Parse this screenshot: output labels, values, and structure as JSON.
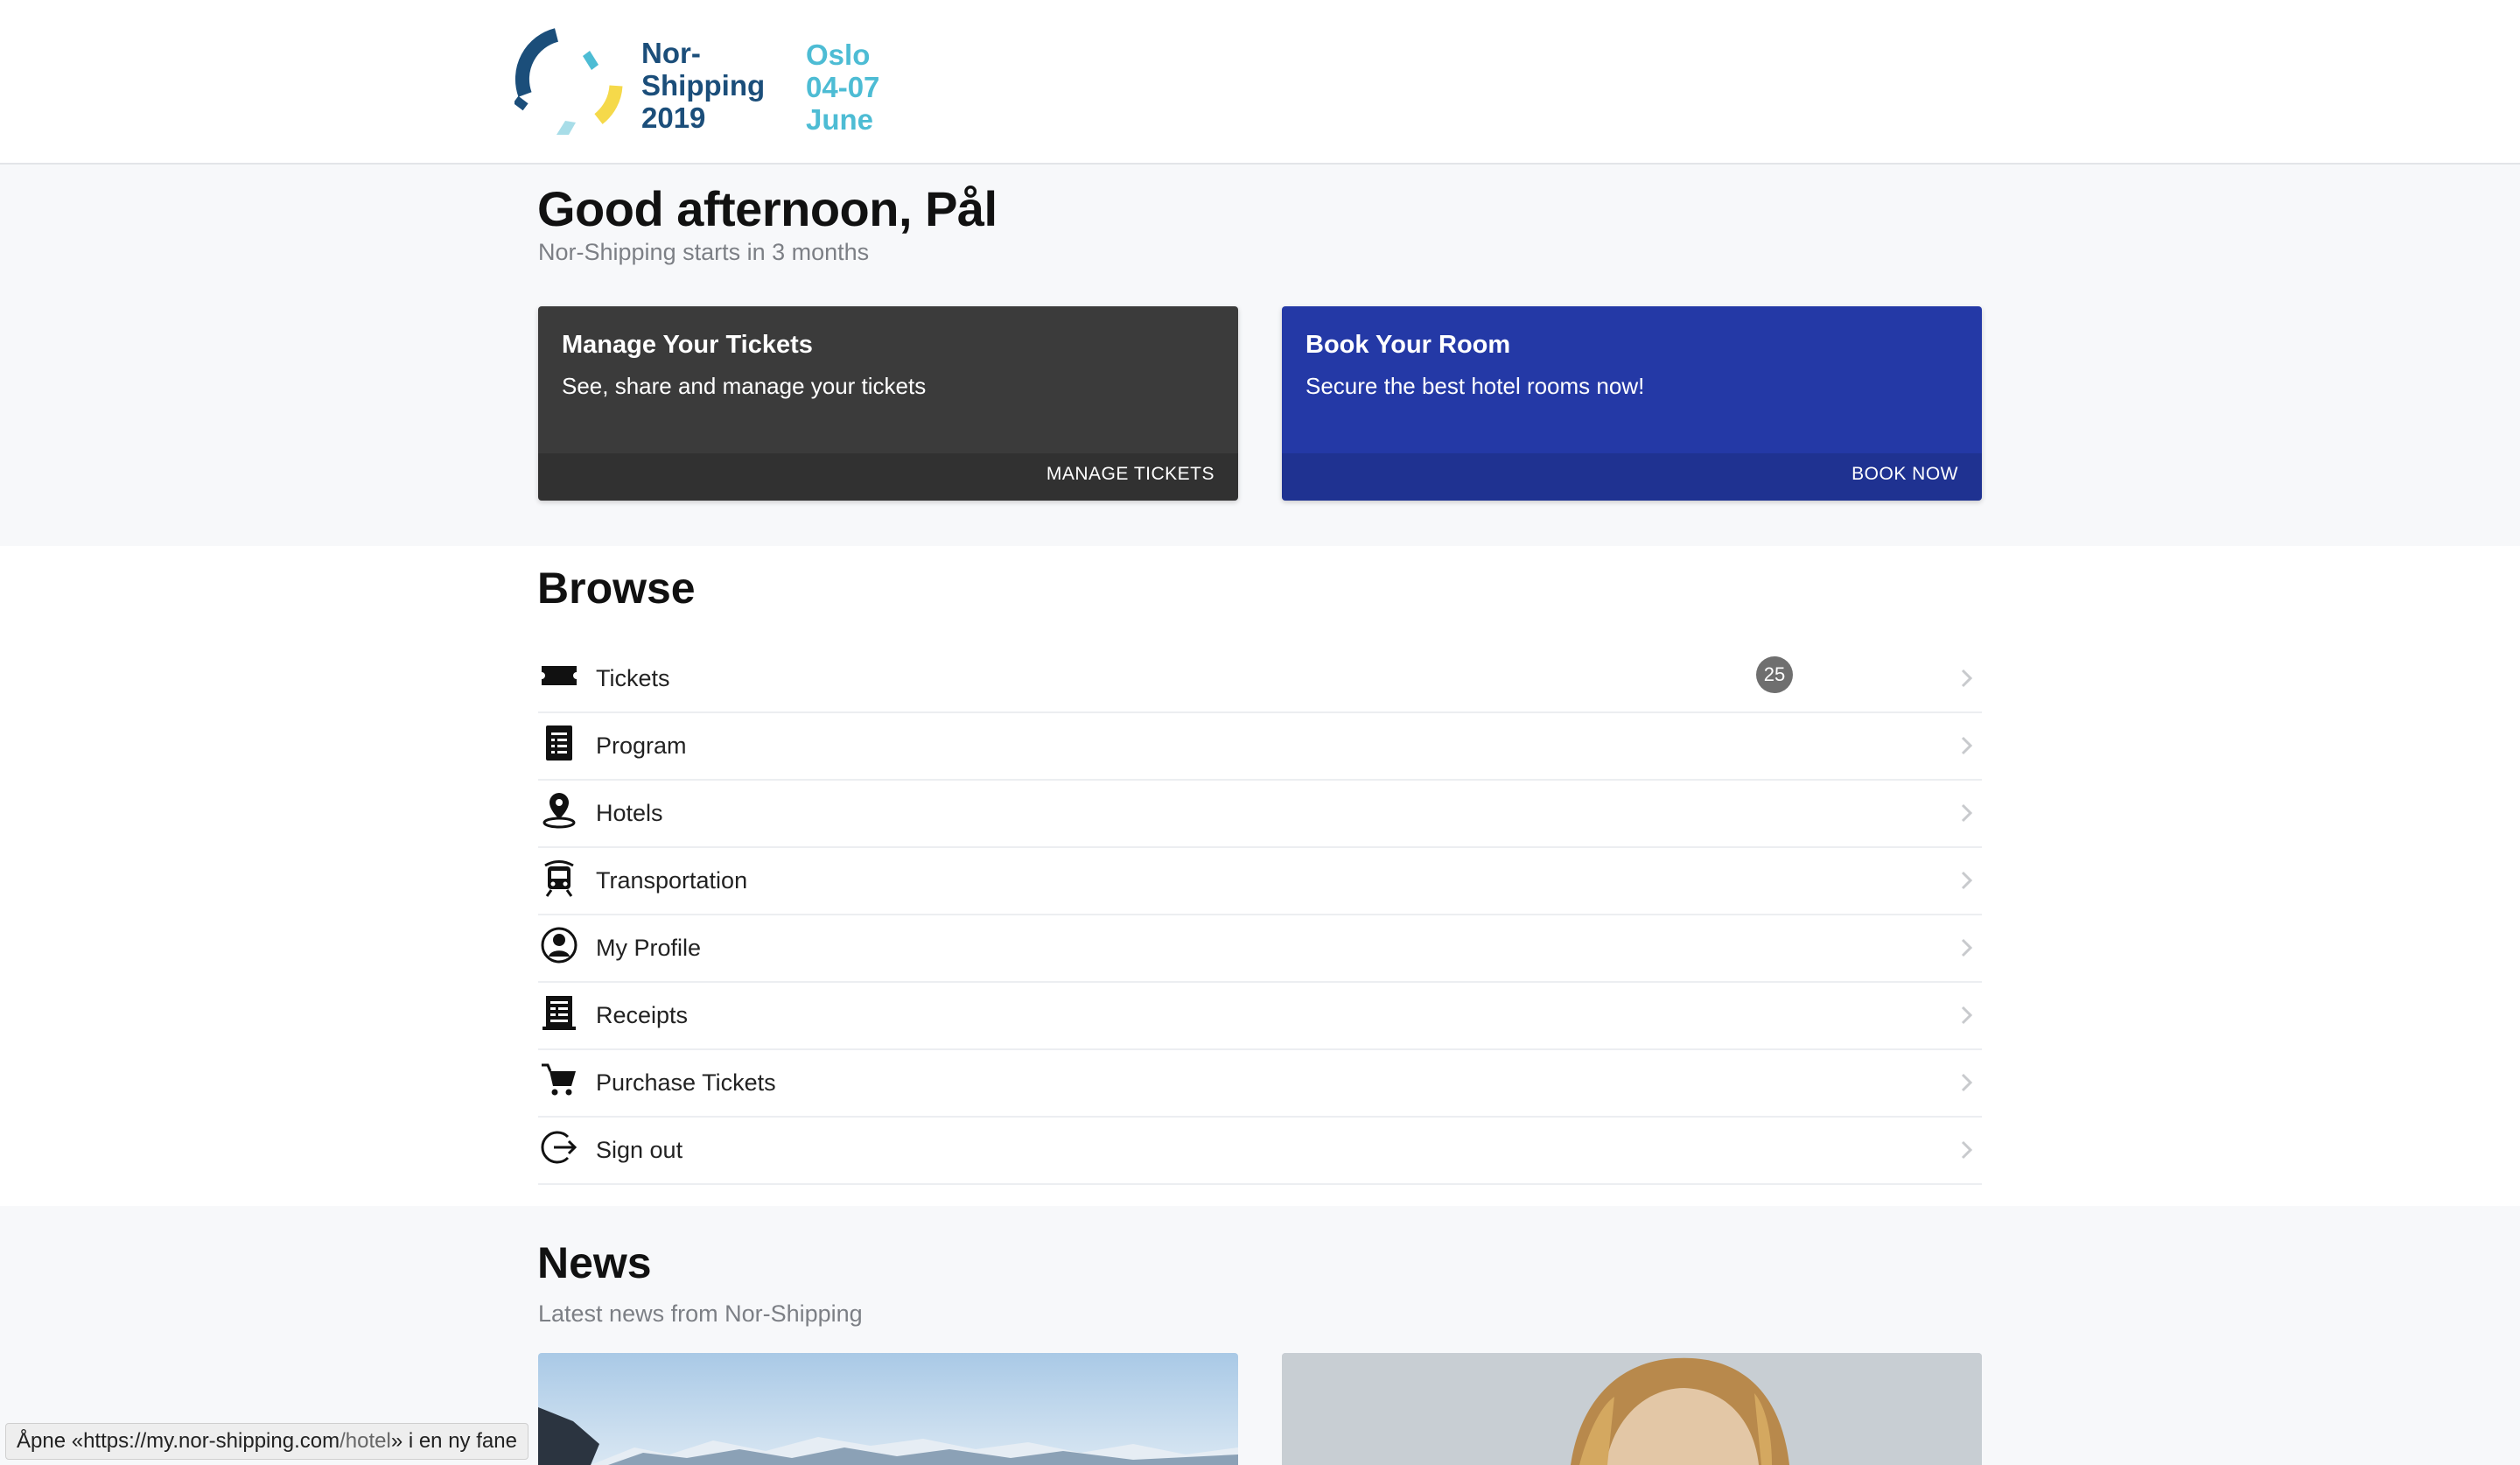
{
  "header": {
    "logo_name_lines": [
      "Nor-",
      "Shipping",
      "2019"
    ],
    "logo_date_lines": [
      "Oslo",
      "04-07",
      "June"
    ],
    "colors": {
      "brand_dark": "#1b4e7a",
      "brand_teal": "#4dbcd4",
      "brand_yellow": "#f5d94a"
    }
  },
  "hero": {
    "greeting": "Good afternoon, Pål",
    "subtitle": "Nor-Shipping starts in 3 months"
  },
  "cards": [
    {
      "title": "Manage Your Tickets",
      "description": "See, share and manage your tickets",
      "action": "MANAGE TICKETS",
      "color": "#3b3b3b"
    },
    {
      "title": "Book Your Room",
      "description": "Secure the best hotel rooms now!",
      "action": "BOOK NOW",
      "color": "#2439a6"
    }
  ],
  "browse": {
    "title": "Browse",
    "items": [
      {
        "label": "Tickets",
        "icon": "ticket-icon",
        "badge": "25"
      },
      {
        "label": "Program",
        "icon": "program-icon"
      },
      {
        "label": "Hotels",
        "icon": "location-pin-icon"
      },
      {
        "label": "Transportation",
        "icon": "train-icon"
      },
      {
        "label": "My Profile",
        "icon": "profile-icon"
      },
      {
        "label": "Receipts",
        "icon": "receipt-icon"
      },
      {
        "label": "Purchase Tickets",
        "icon": "cart-icon"
      },
      {
        "label": "Sign out",
        "icon": "sign-out-icon"
      }
    ]
  },
  "news": {
    "title": "News",
    "subtitle": "Latest news from Nor-Shipping"
  },
  "status_bar": {
    "prefix": "Åpne «",
    "url_host": "https://my.nor-shipping.com",
    "url_path": "/hotel",
    "suffix": "» i en ny fane"
  }
}
